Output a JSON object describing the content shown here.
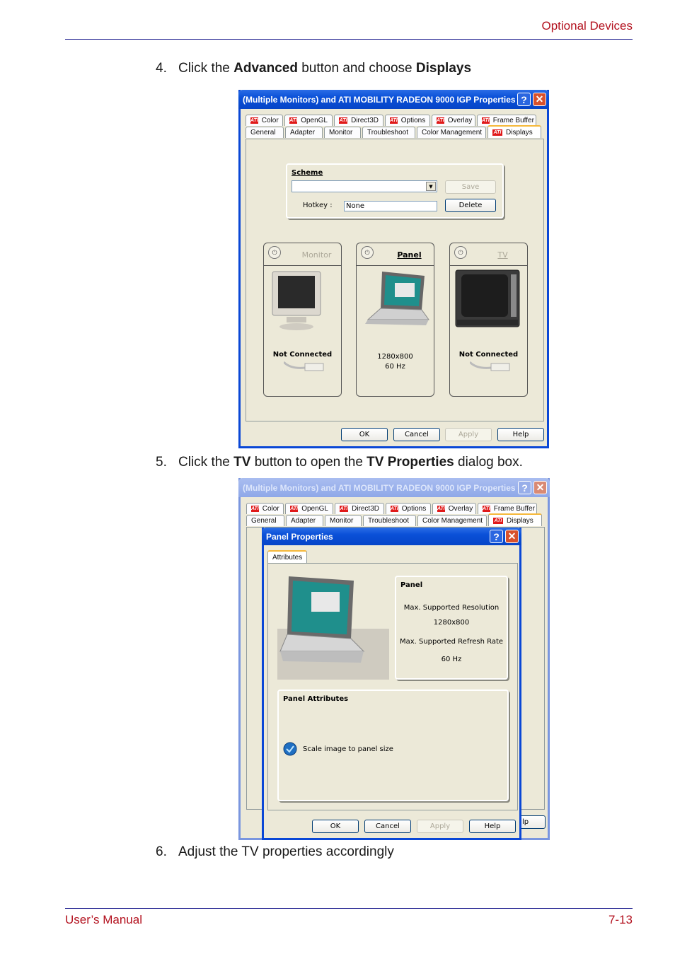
{
  "page": {
    "header_title": "Optional Devices",
    "footer_left": "User’s Manual",
    "footer_right": "7-13",
    "accent_color": "#b3121f",
    "rule_color": "#1a1a8c"
  },
  "steps": [
    {
      "number": "4.",
      "pre": "Click the ",
      "b1": "Advanced",
      "mid": " button and choose ",
      "b2": "Displays",
      "post": ""
    },
    {
      "number": "5.",
      "pre": "Click the ",
      "b1": "TV",
      "mid": " button to open the ",
      "b2": "TV Properties",
      "post": " dialog box."
    },
    {
      "number": "6.",
      "text": "Adjust the TV properties accordingly"
    }
  ],
  "dialog1": {
    "title": "(Multiple Monitors) and ATI MOBILITY RADEON 9000 IGP Properties",
    "help_icon": "?",
    "close_icon": "✕",
    "ati_logo": "ATI",
    "tabs_top": [
      "Color",
      "OpenGL",
      "Direct3D",
      "Options",
      "Overlay",
      "Frame Buffer"
    ],
    "tabs_bottom": [
      "General",
      "Adapter",
      "Monitor",
      "Troubleshoot",
      "Color Management",
      "Displays"
    ],
    "active_tab": "Displays",
    "scheme": {
      "label": "Scheme",
      "value": "",
      "hotkey_label": "Hotkey :",
      "hotkey_value": "None",
      "save_label": "Save",
      "delete_label": "Delete"
    },
    "displays": [
      {
        "name": "Monitor",
        "state": "off",
        "status": "Not Connected"
      },
      {
        "name": "Panel",
        "state": "on",
        "resolution": "1280x800",
        "refresh": "60 Hz"
      },
      {
        "name": "TV",
        "state": "off",
        "status": "Not Connected"
      }
    ],
    "power_icon": "⏻",
    "buttons": {
      "ok": "OK",
      "cancel": "Cancel",
      "apply": "Apply",
      "help": "Help"
    }
  },
  "dialog2": {
    "title": "Panel Properties",
    "help_icon": "?",
    "close_icon": "✕",
    "tab": "Attributes",
    "info": {
      "heading": "Panel",
      "max_res_label": "Max. Supported Resolution",
      "max_res_value": "1280x800",
      "max_refresh_label": "Max. Supported Refresh Rate",
      "max_refresh_value": "60 Hz"
    },
    "attributes": {
      "heading": "Panel Attributes",
      "scale_label": "Scale image to panel size",
      "scale_checked": true
    },
    "buttons": {
      "ok": "OK",
      "cancel": "Cancel",
      "apply": "Apply",
      "help": "Help"
    },
    "behind_help_fragment": "lp"
  }
}
